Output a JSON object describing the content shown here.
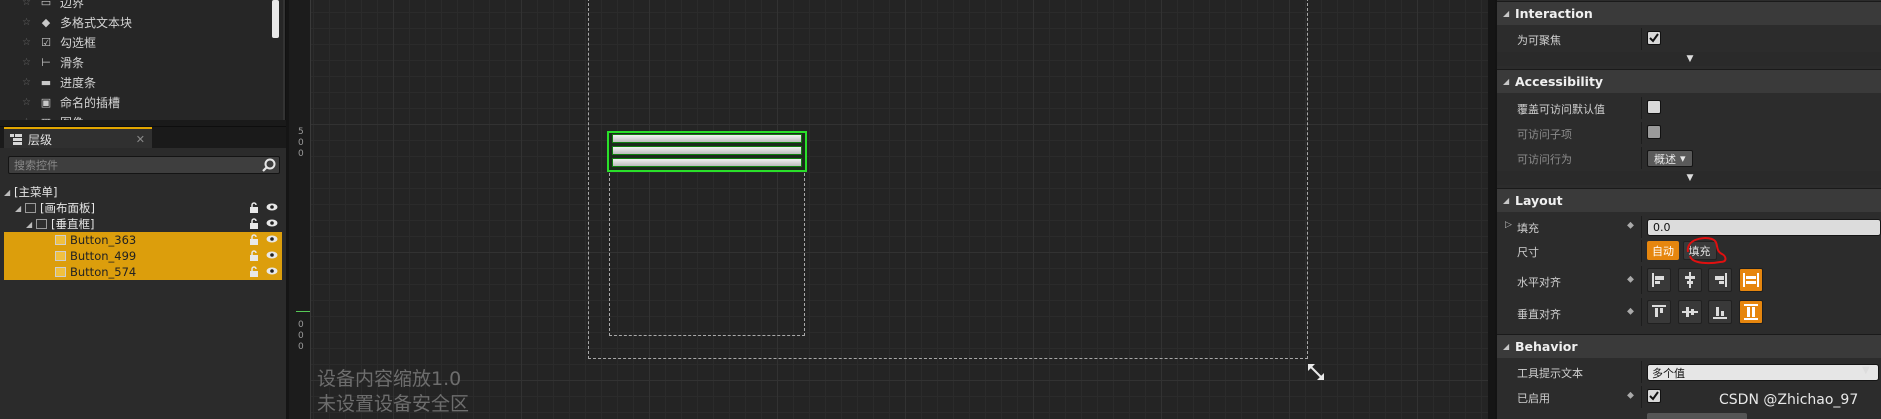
{
  "palette": {
    "items": [
      {
        "label": "边界",
        "icon": "border-icon"
      },
      {
        "label": "多格式文本块",
        "icon": "rich-text-icon"
      },
      {
        "label": "勾选框",
        "icon": "checkbox-icon"
      },
      {
        "label": "滑条",
        "icon": "slider-icon"
      },
      {
        "label": "进度条",
        "icon": "progressbar-icon"
      },
      {
        "label": "命名的插槽",
        "icon": "named-slot-icon"
      },
      {
        "label": "图像",
        "icon": "image-icon"
      }
    ]
  },
  "hierarchy": {
    "tab_label": "层级",
    "search_placeholder": "搜索控件",
    "tree": [
      {
        "label": "[主菜单]",
        "depth": 0,
        "selected": false
      },
      {
        "label": "[画布面板]",
        "depth": 1,
        "selected": false
      },
      {
        "label": "[垂直框]",
        "depth": 2,
        "selected": false
      },
      {
        "label": "Button_363",
        "depth": 3,
        "selected": true
      },
      {
        "label": "Button_499",
        "depth": 3,
        "selected": true
      },
      {
        "label": "Button_574",
        "depth": 3,
        "selected": true
      }
    ]
  },
  "canvas": {
    "ruler_top": [
      "5",
      "0",
      "0"
    ],
    "ruler_bottom": [
      "0",
      "0",
      "0"
    ],
    "dpi_label": "设备内容缩放1.0",
    "safe_zone_label": "未设置设备安全区"
  },
  "details": {
    "sections": {
      "interaction": "Interaction",
      "accessibility": "Accessibility",
      "layout": "Layout",
      "behavior": "Behavior"
    },
    "interaction": {
      "focusable_label": "为可聚焦",
      "focusable_checked": true
    },
    "accessibility": {
      "override_label": "覆盖可访问默认值",
      "children_label": "可访问子项",
      "behavior_label": "可访问行为",
      "behavior_value": "概述"
    },
    "layout": {
      "fill_label": "填充",
      "fill_value": "0.0",
      "size_label": "尺寸",
      "size_auto": "自动",
      "size_fill": "填充",
      "halign_label": "水平对齐",
      "valign_label": "垂直对齐"
    },
    "behavior": {
      "tooltip_label": "工具提示文本",
      "tooltip_value": "多个值",
      "enabled_label": "已启用",
      "enabled_checked": true
    }
  },
  "watermark": "CSDN @Zhichao_97",
  "colors": {
    "selection": "#dc9e0c",
    "accent_orange": "#e6860e",
    "canvas_selection": "#2ae02a",
    "annotation": "#e01010"
  }
}
